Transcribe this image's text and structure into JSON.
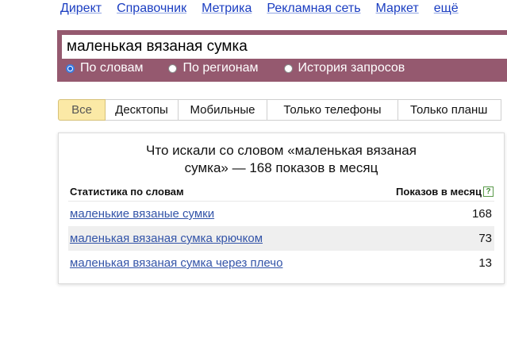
{
  "topnav": {
    "items": [
      "Директ",
      "Справочник",
      "Метрика",
      "Рекламная сеть",
      "Маркет",
      "ещё"
    ]
  },
  "search": {
    "value": "маленькая вязаная сумка",
    "modes": [
      {
        "label": "По словам",
        "checked": true
      },
      {
        "label": "По регионам",
        "checked": false
      },
      {
        "label": "История запросов",
        "checked": false
      }
    ]
  },
  "tabs": {
    "items": [
      "Все",
      "Десктопы",
      "Мобильные",
      "Только телефоны",
      "Только планш"
    ],
    "active": "Все"
  },
  "results": {
    "title_line1": "Что искали со словом «маленькая вязаная",
    "title_line2": "сумка» — 168 показов в месяц",
    "col_keyword": "Статистика по словам",
    "col_shows": "Показов в месяц",
    "help_icon_label": "?",
    "rows": [
      {
        "keyword": "маленькие вязаные сумки",
        "shows": "168"
      },
      {
        "keyword": "маленькая вязаная сумка крючком",
        "shows": "73"
      },
      {
        "keyword": "маленькая вязаная сумка через плечо",
        "shows": "13"
      }
    ]
  },
  "colors": {
    "search_panel": "#95596f",
    "link": "#1a3dc1",
    "active_tab": "#fbe9a6",
    "help_icon": "#3d8a2e"
  }
}
